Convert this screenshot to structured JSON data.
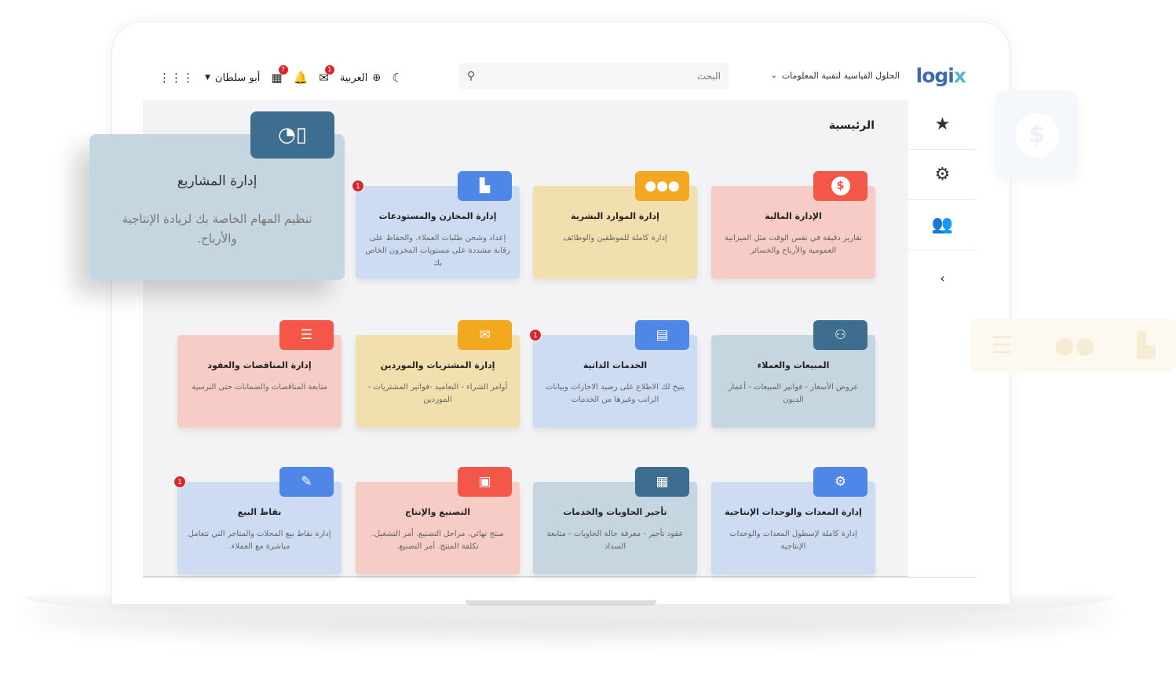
{
  "header": {
    "logo_main": "logi",
    "logo_accent": "x",
    "company": "الحلول القياسية لتقنية المعلومات",
    "search_placeholder": "البحث",
    "language": "العربية",
    "user_name": "أبو سلطان",
    "mail_badge": "1",
    "calendar_badge": "7"
  },
  "page_title": "الرئيسية",
  "popup": {
    "title": "إدارة المشاريع",
    "description": "تنظيم المهام الخاصة بك لزيادة الإنتاجية والأرباح."
  },
  "cards": [
    {
      "title": "الإدارة المالية",
      "desc": "تقارير دقيقة في نفس الوقت مثل الميزانية العمومية والأرباح والخسائر",
      "icon": "$",
      "badge": ""
    },
    {
      "title": "إدارة الموارد البشرية",
      "desc": "إدارة كاملة للموظفين والوظائف",
      "icon": "👥",
      "badge": ""
    },
    {
      "title": "إدارة المخازن والمستودعات",
      "desc": "إعداد وشحن طلبات العملاء. والحفاظ على رقابة مشددة على مستويات المخزون الخاص بك",
      "icon": "🏢",
      "badge": "1"
    },
    {
      "title": "المبيعات والعملاء",
      "desc": "عروض الأسعار - فواتير المبيعات - أعمار الديون",
      "icon": "⚙",
      "badge": ""
    },
    {
      "title": "الخدمات الذاتية",
      "desc": "يتيح لك الاطلاع على رصيد الاجازات وبيانات الراتب وغيرها من الخدمات",
      "icon": "▤",
      "badge": "1"
    },
    {
      "title": "إدارة المشتريات والموردين",
      "desc": "أوامر الشراء - التعاميد -فواتير المشتريات - الموردين",
      "icon": "✉",
      "badge": ""
    },
    {
      "title": "إدارة المناقصات والعقود",
      "desc": "متابعة المناقصات والضمانات حتى الترسية",
      "icon": "☰",
      "badge": ""
    },
    {
      "title": "إدارة المعدات والوحدات الإنتاجية",
      "desc": "إدارة كاملة لإسطول المعدات والوحدات الإنتاجية",
      "icon": "⚙",
      "badge": ""
    },
    {
      "title": "تأجير الحاويات والخدمات",
      "desc": "عقود تأجير - معرفة حالة الحاويات - متابعة السداد",
      "icon": "▦",
      "badge": ""
    },
    {
      "title": "التصنيع والإنتاج",
      "desc": "منتج نهائي. مراحل التصنيع. أمر التشغيل. تكلفة المنتج. أمر التصنيع.",
      "icon": "▣",
      "badge": ""
    },
    {
      "title": "نقاط البيع",
      "desc": "إدارة نقاط بيع المحلات والمتاجر التي تتعامل مباشرة مع العملاء.",
      "icon": "✎",
      "badge": "1"
    }
  ],
  "colors": {
    "finance_bg": "#f7ccc6",
    "finance_icon": "#f4574a",
    "hr_bg": "#f2dfae",
    "hr_icon": "#f2a81f",
    "warehouse_bg": "#cddcf3",
    "warehouse_icon": "#4f87e8",
    "sales_bg": "#c6d6e1",
    "sales_icon": "#3d6e8f",
    "self_bg": "#cddcf3",
    "self_icon": "#4f87e8",
    "purchase_bg": "#f2dfae",
    "purchase_icon": "#f2a81f",
    "tender_bg": "#f7ccc6",
    "tender_icon": "#f4574a"
  }
}
